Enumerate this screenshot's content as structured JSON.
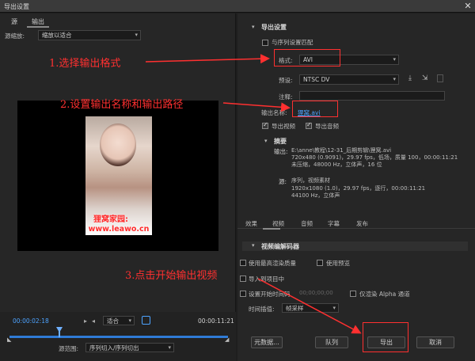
{
  "window": {
    "title": "导出设置",
    "close_glyph": "✕"
  },
  "left_tabs": [
    {
      "label": "源"
    },
    {
      "label": "输出"
    }
  ],
  "source_scaling": {
    "label": "源缩放:",
    "value": "缩放以适合"
  },
  "preview": {
    "watermark_line1": "狸窝家园:",
    "watermark_line2": "www.leawo.cn"
  },
  "timeline": {
    "timecode_in": "00:00:02:18",
    "timecode_out": "00:00:11:21",
    "fit_value": "适合",
    "source_range_label": "源范围:",
    "source_range_value": "序列切入/序列切出",
    "playhead_fraction": 0.23
  },
  "export_settings": {
    "section_title": "导出设置",
    "match_sequence_label": "与序列设置匹配",
    "format_label": "格式:",
    "format_value": "AVI",
    "preset_label": "预设:",
    "preset_value": "NTSC DV",
    "comment_label": "注释:",
    "comment_value": "",
    "output_name_label": "输出名称:",
    "output_name_value": "狸窝.avi",
    "export_video_label": "导出视频",
    "export_audio_label": "导出音频"
  },
  "summary": {
    "title": "摘要",
    "output_label": "输出:",
    "output_lines": [
      "E:\\anne\\教程\\12-31_后期剪辑\\狸窝.avi",
      "720x480 (0.9091)，29.97 fps，低场，质量 100，00:00:11:21",
      "未压缩，48000 Hz，立体声，16 位"
    ],
    "source_label": "源:",
    "source_lines": [
      "序列，视频素材",
      "1920x1080 (1.0)，29.97 fps，逐行，00:00:11:21",
      "44100 Hz，立体声"
    ]
  },
  "bottom_tabs": [
    {
      "label": "效果"
    },
    {
      "label": "视频"
    },
    {
      "label": "音频"
    },
    {
      "label": "字幕"
    },
    {
      "label": "发布"
    }
  ],
  "codec_section": {
    "title": "视频编解码器"
  },
  "options": {
    "max_render_quality": "使用最高渲染质量",
    "use_previews": "使用预览",
    "import_into_project": "导入到项目中",
    "set_start_timecode": "设置开始时间码",
    "start_timecode_value": "00;00;00;00",
    "render_alpha_only": "仅渲染 Alpha 通道",
    "time_interpolation_label": "时间插值:",
    "time_interpolation_value": "帧采样"
  },
  "buttons": {
    "metadata": "元数据...",
    "queue": "队列",
    "export": "导出",
    "cancel": "取消"
  },
  "annotations": {
    "step1": "1.选择输出格式",
    "step2": "2.设置输出名称和输出路径",
    "step3": "3.点击开始输出视频"
  },
  "colors": {
    "annotation_red": "#ff3030",
    "link_blue": "#4da3ff",
    "timeline_blue": "#2f7bd6"
  }
}
